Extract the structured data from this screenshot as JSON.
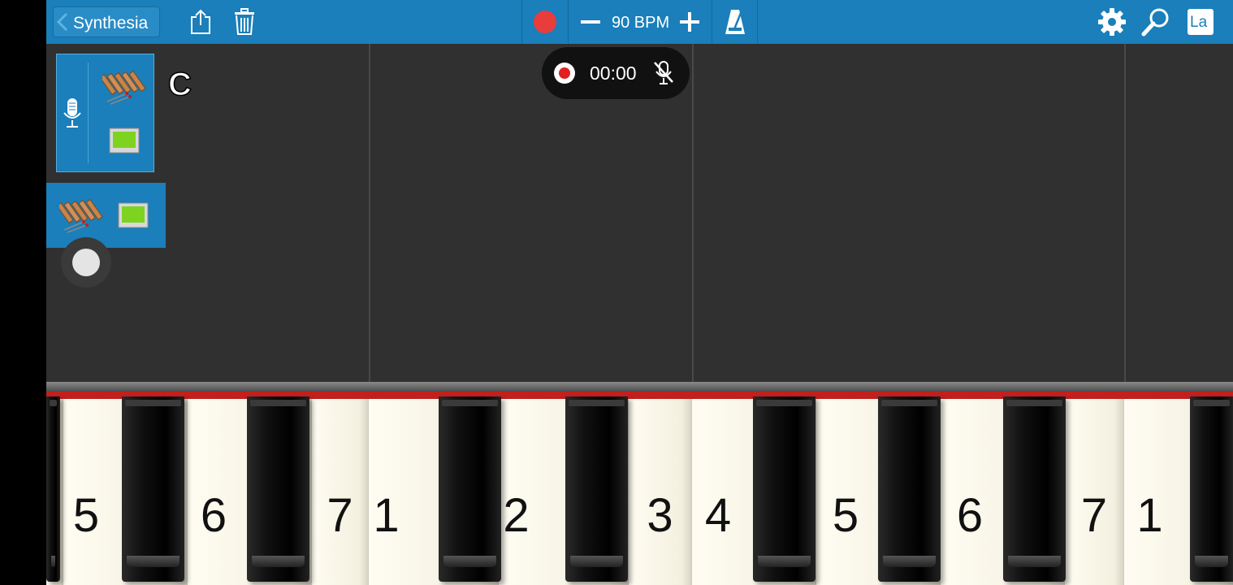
{
  "toolbar": {
    "back_label": "Synthesia",
    "bpm_label": "90 BPM",
    "language_label": "La",
    "icons": [
      "share-icon",
      "trash-icon",
      "record-icon",
      "minus-icon",
      "plus-icon",
      "metronome-icon",
      "gear-icon",
      "search-icon"
    ]
  },
  "track": {
    "key_label": "C",
    "instrument": "xylophone-icon"
  },
  "recorder": {
    "time": "00:00"
  },
  "piano": {
    "white_keys": [
      "",
      "5",
      "6",
      "7",
      "1",
      "2",
      "3",
      "4",
      "5",
      "6",
      "7",
      "1"
    ]
  },
  "colors": {
    "toolbar": "#1a7fba",
    "record": "#e93c3c",
    "background": "#303030",
    "accent_red": "#c0201e",
    "screen_green": "#7ed321"
  }
}
